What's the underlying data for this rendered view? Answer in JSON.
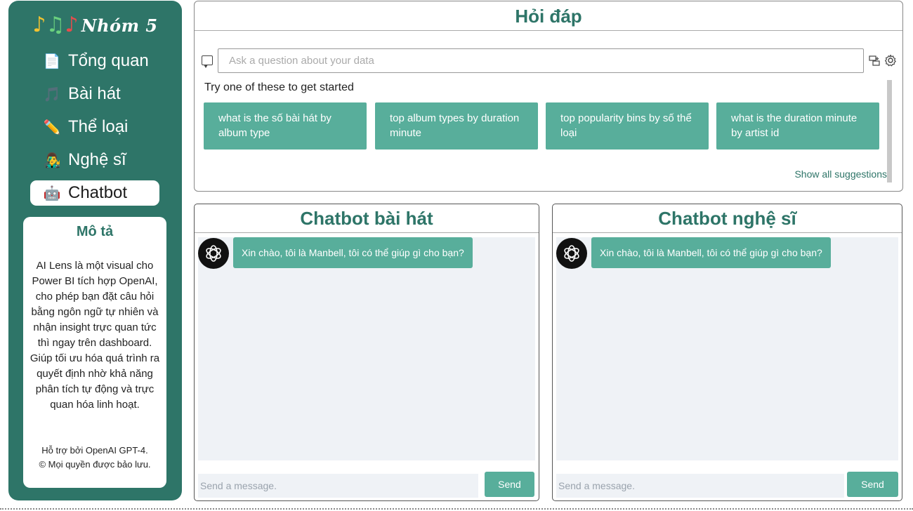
{
  "brand": {
    "name": "Nhóm 5",
    "notes": "♪♫♪"
  },
  "sidebar": {
    "items": [
      {
        "label": "Tổng quan",
        "icon": "document-icon",
        "glyph": "📄"
      },
      {
        "label": "Bài hát",
        "icon": "music-note-icon",
        "glyph": "🎵"
      },
      {
        "label": "Thể loại",
        "icon": "pencil-icon",
        "glyph": "✏️"
      },
      {
        "label": "Nghệ sĩ",
        "icon": "singer-icon",
        "glyph": "👨‍🎤"
      },
      {
        "label": "Chatbot",
        "icon": "robot-icon",
        "glyph": "🤖",
        "active": true
      }
    ]
  },
  "description": {
    "title": "Mô tả",
    "body": "AI Lens là một visual cho Power BI tích hợp OpenAI, cho phép bạn đặt câu hỏi bằng ngôn ngữ tự nhiên và nhận insight trực quan tức thì ngay trên dashboard. Giúp tối ưu hóa quá trình ra quyết định nhờ khả năng phân tích tự động và trực quan hóa linh hoạt.",
    "footer_line1": "Hỗ trợ bởi OpenAI GPT-4.",
    "footer_line2": "© Mọi quyền được bảo lưu."
  },
  "qa": {
    "title": "Hỏi đáp",
    "input_placeholder": "Ask a question about your data",
    "try_text": "Try one of these to get started",
    "suggestions": [
      "what is the số bài hát by album type",
      "top album types by duration minute",
      "top popularity bins by số thể loại",
      "what is the duration minute by artist id"
    ],
    "show_all": "Show all suggestions"
  },
  "chat_song": {
    "title": "Chatbot bài hát",
    "greeting": "Xin chào, tôi là Manbell, tôi có thể giúp gì cho bạn?",
    "placeholder": "Send a message.",
    "send": "Send"
  },
  "chat_artist": {
    "title": "Chatbot nghệ sĩ",
    "greeting": "Xin chào, tôi là Manbell, tôi có thể giúp gì cho bạn?",
    "placeholder": "Send a message.",
    "send": "Send"
  },
  "colors": {
    "primary": "#2e7568",
    "accent": "#58ae9b",
    "chat_bg": "#eff2f6"
  }
}
